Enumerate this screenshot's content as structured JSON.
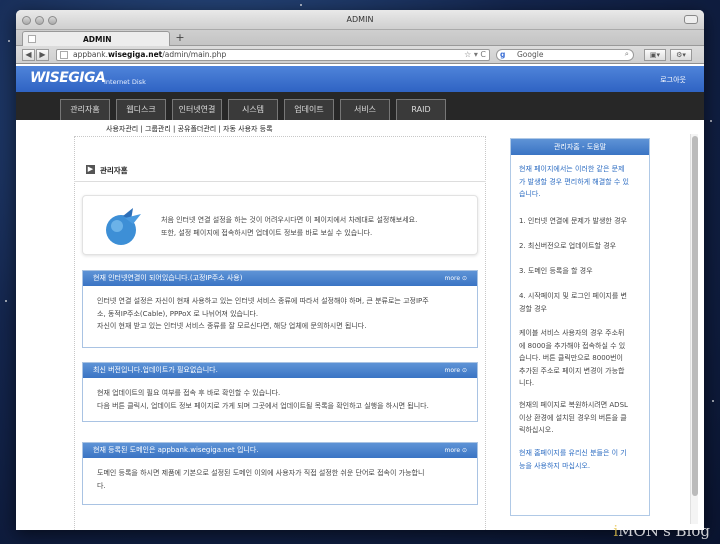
{
  "window": {
    "title": "ADMIN"
  },
  "tabs": [
    {
      "label": "ADMIN"
    }
  ],
  "newtab": "+",
  "nav": {
    "back": "◀",
    "forward": "▶"
  },
  "address": {
    "prefix": "appbank.",
    "domain": "wisegiga.net",
    "path": "/admin/main.php",
    "icons": "☆ ▾ C"
  },
  "search": {
    "engine_glyph": "g",
    "placeholder": "Google",
    "icon": "⌕"
  },
  "toolbar": {
    "btn1": "▣▾",
    "btn2": "⚙▾"
  },
  "brand": {
    "logo": "WISEGIGA",
    "sub": "Internet Disk",
    "logout": "로그아웃"
  },
  "menu": [
    {
      "label": "관리자홈"
    },
    {
      "label": "웹디스크"
    },
    {
      "label": "인터넷연결"
    },
    {
      "label": "시스템"
    },
    {
      "label": "업데이트"
    },
    {
      "label": "서비스"
    },
    {
      "label": "RAID"
    }
  ],
  "submenu": "사용자관리 | 그룹관리 | 공유폴더관리 | 자동 사용자 등록",
  "section": {
    "icon": "▶",
    "title": "관리자홈"
  },
  "welcome": {
    "line1": "처음 인터넷 연결 설정을 하는 것이 어려우시다면 이 페이지에서 차례대로 설정해보세요.",
    "line2": "또한, 설정 페이지에 접속하시면 업데이트 정보를 바로 보실 수 있습니다."
  },
  "panels": [
    {
      "title": "현재 인터넷연결이 되어있습니다.(고정IP주소 사용)",
      "more": "more ⊙",
      "lines": [
        "인터넷 연결 설정은 자신이 현재 사용하고 있는 인터넷 서비스 종류에 따라서 설정해야 하며, 큰 분류로는 고정IP주",
        "소, 동적IP주소(Cable), PPPoX 로 나뉘어져 있습니다.",
        "자신이 현재 받고 있는 인터넷 서비스 종류를 잘 모르신다면, 해당 업체에 문의하시면 됩니다."
      ]
    },
    {
      "title": "최신 버전입니다.업데이트가 필요없습니다.",
      "more": "more ⊙",
      "lines": [
        "현재 업데이트의 필요 여부를 접속 후 바로 확인할 수 있습니다.",
        "다음 버튼 클릭시, 업데이트 정보 페이지로 가게 되며 그곳에서 업데이트될 목록을 확인하고 실행을 하시면 됩니다."
      ]
    },
    {
      "title": "현재 등록된 도메인은 appbank.wisegiga.net 입니다.",
      "more": "more ⊙",
      "lines": [
        "도메인 등록을 하시면 제품에 기본으로 설정된 도메인 이외에 사용자가 직접 설정한 쉬운 단어로 접속이 가능합니",
        "다."
      ]
    }
  ],
  "help": {
    "title": "관리자홈 - 도움말",
    "intro": [
      "현재 페이지에서는 이러한 같은 문제",
      "가 발생할 경우 편리하게 해결할 수 있",
      "습니다."
    ],
    "items": [
      "1. 인터넷 연결에 문제가 발생한 경우",
      "2. 최신버전으로 업데이트할 경우",
      "3. 도메인 등록을 할 경우",
      "4. 시작페이지 및 로그인 페이지를 변",
      "경할 경우"
    ],
    "note": [
      "케이블 서비스 사용자의 경우 주소뒤",
      "에 8000을 추가해야 접속하실 수 있",
      "습니다. 버튼 클릭만으로 8000번이",
      "추가된 주소로 페이지 변경이 가능합",
      "니다."
    ],
    "note2": [
      "현재의 페이지로 복원하시려면 ADSL",
      "이상 환경에 설치된 경우의 버튼을 클",
      "릭하십시오."
    ],
    "footer": [
      "현재 홈페이지를 유리신 분들은 이 기",
      "능을 사용하지 마십시오."
    ]
  },
  "watermark": {
    "i": "i",
    "rest": "MON's Blog"
  }
}
